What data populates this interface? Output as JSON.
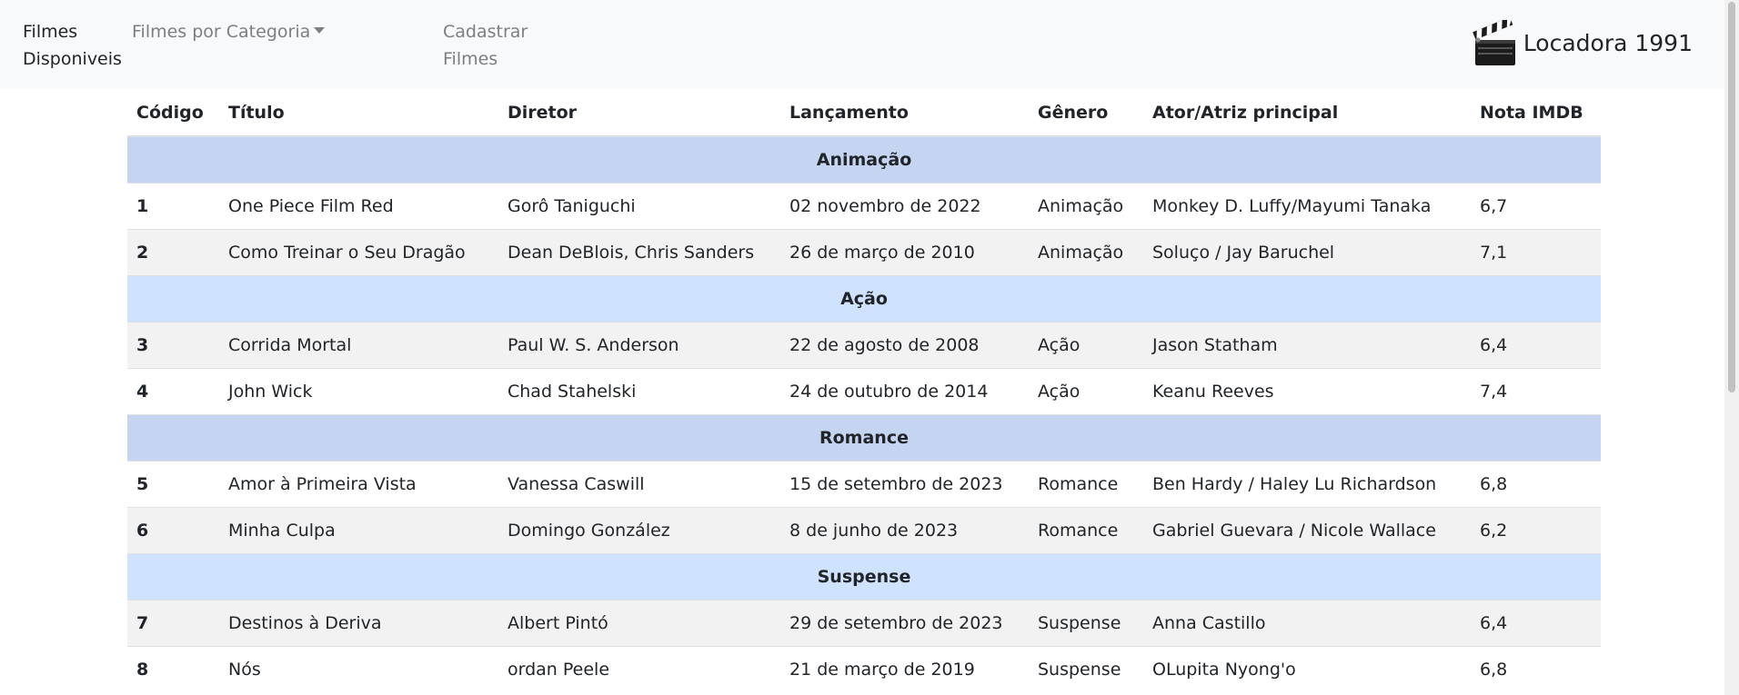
{
  "navbar": {
    "filmes_disponiveis": "Filmes Disponiveis",
    "filmes_por_categoria": "Filmes por Categoria",
    "cadastrar_filmes": "Cadastrar Filmes",
    "brand": "Locadora 1991",
    "brand_icon": "clapperboard-icon"
  },
  "table": {
    "headers": [
      "Código",
      "Título",
      "Diretor",
      "Lançamento",
      "Gênero",
      "Ator/Atriz principal",
      "Nota IMDB"
    ],
    "groups": [
      {
        "name": "Animação",
        "rows": [
          [
            "1",
            "One Piece Film Red",
            "Gorô Taniguchi",
            "02 novembro de 2022",
            "Animação",
            "Monkey D. Luffy/Mayumi Tanaka",
            "6,7"
          ],
          [
            "2",
            "Como Treinar o Seu Dragão",
            "Dean DeBlois, Chris Sanders",
            "26 de março de 2010",
            "Animação",
            "Soluço / Jay Baruchel",
            "7,1"
          ]
        ]
      },
      {
        "name": "Ação",
        "rows": [
          [
            "3",
            "Corrida Mortal",
            "Paul W. S. Anderson",
            "22 de agosto de 2008",
            "Ação",
            "Jason Statham",
            "6,4"
          ],
          [
            "4",
            "John Wick",
            "Chad Stahelski",
            "24 de outubro de 2014",
            "Ação",
            "Keanu Reeves",
            "7,4"
          ]
        ]
      },
      {
        "name": "Romance",
        "rows": [
          [
            "5",
            "Amor à Primeira Vista",
            "Vanessa Caswill",
            "15 de setembro de 2023",
            "Romance",
            "Ben Hardy / Haley Lu Richardson",
            "6,8"
          ],
          [
            "6",
            "Minha Culpa",
            "Domingo González",
            "8 de junho de 2023",
            "Romance",
            "Gabriel Guevara / Nicole Wallace",
            "6,2"
          ]
        ]
      },
      {
        "name": "Suspense",
        "rows": [
          [
            "7",
            "Destinos à Deriva",
            "Albert Pintó",
            "29 de setembro de 2023",
            "Suspense",
            "Anna Castillo",
            "6,4"
          ],
          [
            "8",
            "Nós",
            "ordan Peele",
            "21 de março de 2019",
            "Suspense",
            "OLupita Nyong'o",
            "6,8"
          ]
        ]
      }
    ]
  },
  "colors": {
    "navbar_bg": "#f8f9fa",
    "group_row_a": "#c5d5f1",
    "group_row_b": "#cfe2fe",
    "striped_row": "#f2f2f2"
  }
}
